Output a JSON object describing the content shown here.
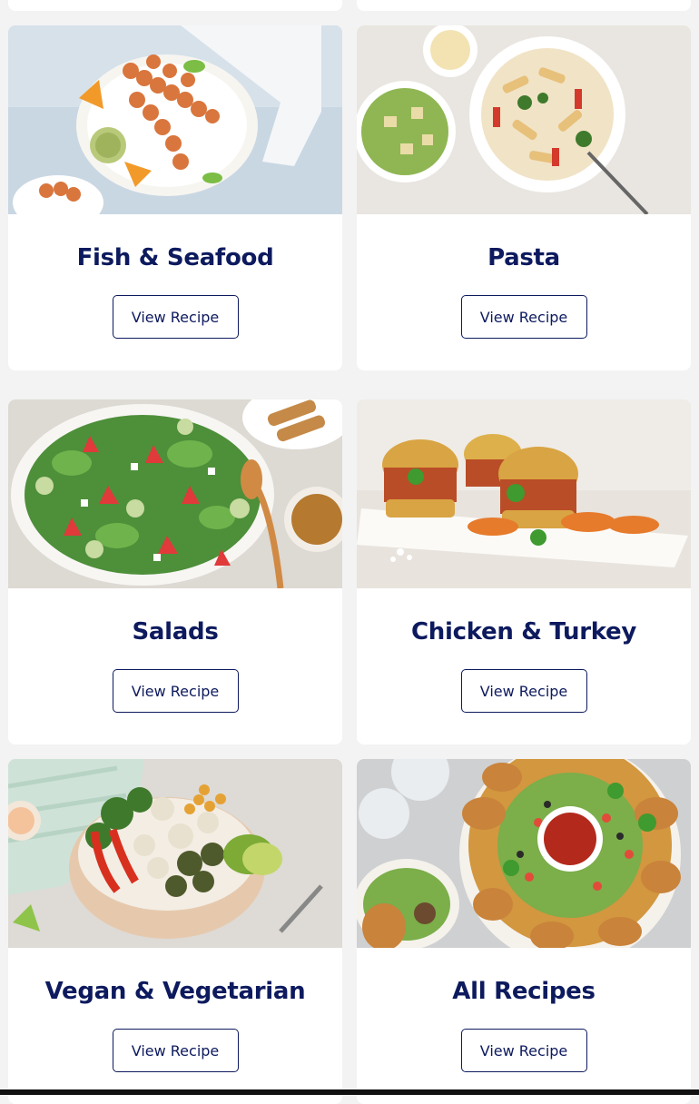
{
  "colors": {
    "page_bg": "#f3f3f3",
    "card_bg": "#ffffff",
    "title": "#0d1a5e",
    "button_border": "#0d1a5e"
  },
  "categories": [
    {
      "title": "Fish & Seafood",
      "button": "View Recipe",
      "image": "shrimp-skewers-photo"
    },
    {
      "title": "Pasta",
      "button": "View Recipe",
      "image": "penne-pasta-photo"
    },
    {
      "title": "Salads",
      "button": "View Recipe",
      "image": "strawberry-salad-photo"
    },
    {
      "title": "Chicken & Turkey",
      "button": "View Recipe",
      "image": "pulled-chicken-sliders-photo"
    },
    {
      "title": "Vegan & Vegetarian",
      "button": "View Recipe",
      "image": "veggie-bowl-photo"
    },
    {
      "title": "All Recipes",
      "button": "View Recipe",
      "image": "taco-ring-photo"
    }
  ]
}
